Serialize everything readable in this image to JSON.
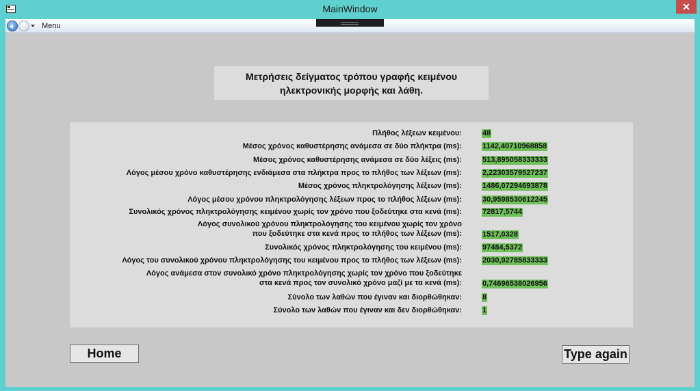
{
  "window": {
    "title": "MainWindow",
    "close_glyph": "✕"
  },
  "menubar": {
    "menu_label": "Menu"
  },
  "heading": "Μετρήσεις δείγματος τρόπου γραφής κειμένου ηλεκτρονικής μορφής και λάθη.",
  "metrics": [
    {
      "label": "Πλήθος λέξεων κειμένου:",
      "value": "48"
    },
    {
      "label": "Μέσος χρόνος καθυστέρησης ανάμεσα σε δύο πλήκτρα (ms):",
      "value": "1142,40710968858"
    },
    {
      "label": "Μέσος χρόνος καθυστέρησης ανάμεσα σε δύο λέξεις (ms):",
      "value": "513,895058333333"
    },
    {
      "label": "Λόγος μέσου χρόνο καθυστέρησης ενδιάμεσα στα πλήκτρα προς το πλήθος των λέξεων (ms):",
      "value": "2,22303579527237"
    },
    {
      "label": "Μέσος χρόνος πληκτρολόγησης λέξεων (ms):",
      "value": "1486,07294693878"
    },
    {
      "label": "Λόγος μέσου χρόνου πληκτρολόγησης λέξεων προς το πλήθος λέξεων (ms):",
      "value": "30,9598530612245"
    },
    {
      "label": "Συνολικός χρόνος πληκτρολόγησης κειμένου χωρίς τον χρόνο που ξοδεύτηκε στα κενά (ms):",
      "value": "72817,5744"
    },
    {
      "label_line1": "Λόγος συνολικού χρόνου πληκτρολόγησης του κειμένου χωρίς τον χρόνο",
      "label_line2": "που ξοδεύτηκε στα κενά προς το πλήθος των λέξεων (ms):",
      "value": "1517,0328"
    },
    {
      "label": "Συνολικός χρόνος πληκτρολόγησης του κειμένου (ms):",
      "value": "97484,5372"
    },
    {
      "label": "Λόγος του συνολικού χρόνου πληκτρολόγησης του κειμένου προς το πλήθος των λέξεων (ms):",
      "value": "2030,92785833333"
    },
    {
      "label_line1": "Λόγος ανάμεσα στον συνολικό χρόνο πληκτρολόγησης χωρίς τον χρόνο που ξοδεύτηκε",
      "label_line2": "στα κενά προς τον συνολικό χρόνο μαζί με τα κενά (ms):",
      "value": "0,74696538026956"
    },
    {
      "label": "Σύνολο των λαθών που έγιναν και διορθώθηκαν:",
      "value": "8"
    },
    {
      "label": "Σύνολο των λαθών που έγιναν και δεν διορθώθηκαν:",
      "value": "1"
    }
  ],
  "buttons": {
    "home": "Home",
    "type_again": "Type again"
  },
  "colors": {
    "frame": "#5fd0d0",
    "close": "#c74e4e",
    "value_highlight": "#6fbf5a",
    "panel": "#dcdcdc",
    "background": "#c8c8c8"
  }
}
